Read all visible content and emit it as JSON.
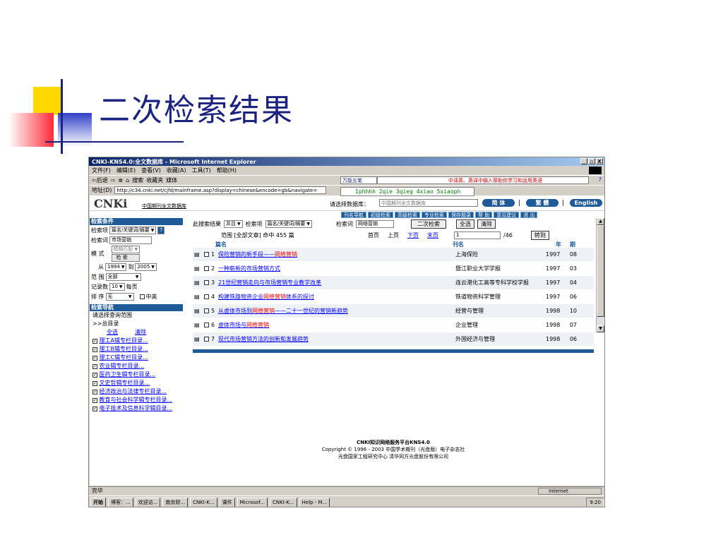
{
  "slide": {
    "title": "二次检索结果"
  },
  "window": {
    "title": "CNKI-KNS4.0:全文数据库 - Microsoft Internet Explorer",
    "controls": [
      "_",
      "▫",
      "X"
    ],
    "menu": [
      "文件(F)",
      "编辑(E)",
      "查看(V)",
      "收藏(A)",
      "工具(T)",
      "帮助(H)"
    ],
    "toolbar": [
      "⇦后退",
      "⇨",
      "⊗",
      "⌂",
      "搜索",
      "收藏夹",
      "媒体"
    ],
    "address_label": "地址(D)",
    "address": "http://c34.cnki.net/cjfd/mainframe.asp?display=chinese&encode=gb&navigate=",
    "wanneng": "万能五笔",
    "wanneng_hint": "中译英、英译中输入帮助你学习和运用英语",
    "help_q": "?",
    "pinyin": "1phhhh 2qie 3qieg 4xiao 5xiaoph"
  },
  "page": {
    "logo": "CNKi",
    "logo_sub": "中国期刊全文数据库",
    "db_label": "请选择数据库：",
    "db_value": "中国期刊全文数据库",
    "btn_simplified": "简 体",
    "btn_traditional": "繁 體",
    "btn_english": "English",
    "sep": "|",
    "nav": [
      "刊名导航",
      "初级检索",
      "高级检索",
      "专业检索",
      "保存题录",
      "帮 助",
      "意见建议",
      "退 出"
    ],
    "left": {
      "cond_head": "检索条件",
      "field_label": "检索项",
      "field_value": "篇名/关键词/摘要",
      "help_btn": "?",
      "term_label": "检索词",
      "term_value": "市场营销",
      "mode_label": "模  式",
      "mode_value": "模糊匹配",
      "search_btn": "检 索",
      "from_label": "从",
      "from_value": "1994",
      "to_label": "到",
      "to_value": "2005",
      "range_label": "范  围",
      "range_value": "全部",
      "count_label": "记录数",
      "count_value": "10",
      "per_page": "每页",
      "sort_label": "排  序",
      "sort_value": "无",
      "zh_en": "中英",
      "nav_head": "检索导航",
      "nav_sub": "请选择查询范围",
      "nav_root": ">>总目录",
      "select_all": "全选",
      "clear": "清除",
      "items": [
        "理工A辑专栏目录...",
        "理工B辑专栏目录...",
        "理工C辑专栏目录...",
        "农业辑专栏目录...",
        "医药卫生辑专栏目录...",
        "文史哲辑专栏目录...",
        "经济政治与法律专栏目录...",
        "教育与社会科学辑专栏目录...",
        "电子技术及信息科学辑目录..."
      ]
    },
    "main": {
      "in_results": "此搜索结果",
      "logic": "并且",
      "field_label": "检索项",
      "field_value": "篇名/关键词/摘要",
      "term_label": "检索词",
      "term_value": "网络营销",
      "secondary_btn": "二次检索",
      "select_all_btn": "全选",
      "clear_btn": "清除",
      "scope": "范围 [全部文章] 命中 455 篇",
      "first": "首页",
      "prev": "上页",
      "next": "下页",
      "last": "末页",
      "page_value": "1",
      "page_total": "/46",
      "goto_btn": "转到",
      "col_title": "篇名",
      "col_journal": "刊名",
      "col_year": "年",
      "col_issue": "期",
      "rows": [
        {
          "n": "1",
          "pre": "保险营销的新手段——",
          "hi": "网络营销",
          "post": "",
          "journal": "上海保险",
          "year": "1997",
          "issue": "08"
        },
        {
          "n": "2",
          "pre": "一种崭新的市场营销方式",
          "hi": "",
          "post": "",
          "journal": "暨江职业大学学报",
          "year": "1997",
          "issue": "03"
        },
        {
          "n": "3",
          "pre": "21世纪营销走向与市场营销专业教学改革",
          "hi": "",
          "post": "",
          "journal": "连云港化工高等专科学校学报",
          "year": "1997",
          "issue": "04"
        },
        {
          "n": "4",
          "pre": "构建铁路物资企业",
          "hi": "网络营销",
          "post": "体系的探讨",
          "journal": "铁道物资科学管理",
          "year": "1997",
          "issue": "06"
        },
        {
          "n": "5",
          "pre": "从虚体市场到",
          "hi": "网络营销",
          "post": "——二十一世纪的营销新趋势",
          "journal": "经营与管理",
          "year": "1998",
          "issue": "10"
        },
        {
          "n": "6",
          "pre": "虚体市场与",
          "hi": "网络营销",
          "post": "",
          "journal": "企业管理",
          "year": "1998",
          "issue": "07"
        },
        {
          "n": "7",
          "pre": "现代市场营销方法的创新和发展趋势",
          "hi": "",
          "post": "",
          "journal": "外国经济与管理",
          "year": "1998",
          "issue": "06"
        }
      ],
      "footer1": "CNKI知识网络服务平台KNS4.0",
      "footer2": "Copyright © 1996 - 2003  中国学术期刊（光盘版）电子杂志社",
      "footer3": "光盘国家工程研究中心   清华同方光盘股份有限公司"
    }
  },
  "status": {
    "text": "完毕",
    "zone": "Internet"
  },
  "taskbar": {
    "start": "开始",
    "tasks": [
      "博客：...",
      "欢迎访...",
      "南京财...",
      "CNKI-K...",
      "课件",
      "Microsof...",
      "CNKI-K...",
      "Help - M..."
    ],
    "clock": "9:20"
  }
}
